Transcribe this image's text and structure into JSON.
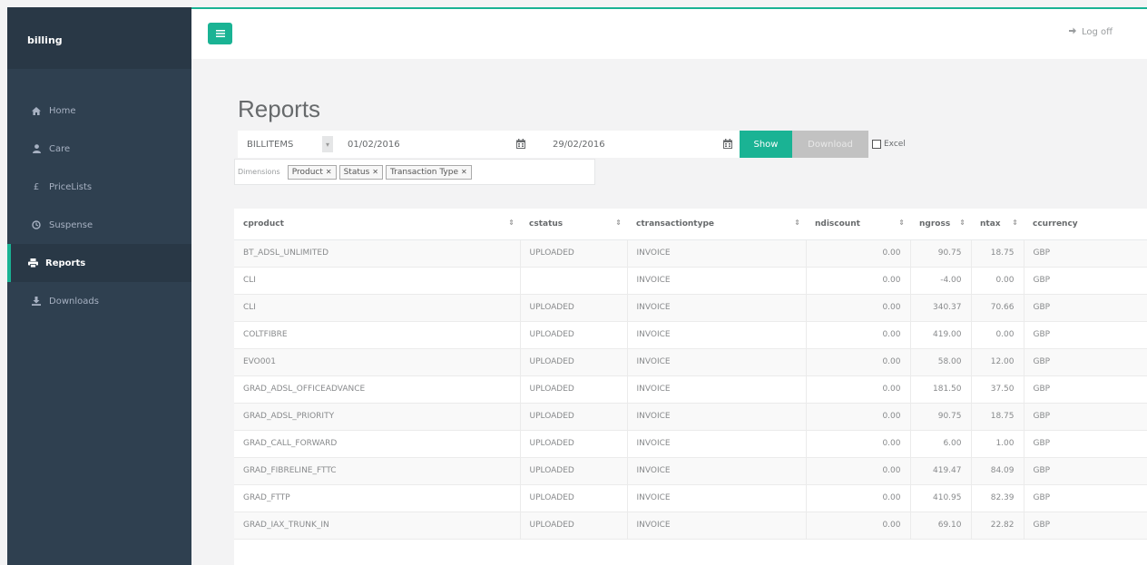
{
  "app": {
    "brand": "billing"
  },
  "sidebar": {
    "items": [
      {
        "label": "Home",
        "icon": "home-icon"
      },
      {
        "label": "Care",
        "icon": "user-icon"
      },
      {
        "label": "PriceLists",
        "icon": "pound-icon"
      },
      {
        "label": "Suspense",
        "icon": "clock-icon"
      },
      {
        "label": "Reports",
        "icon": "print-icon",
        "active": true
      },
      {
        "label": "Downloads",
        "icon": "download-icon"
      }
    ]
  },
  "topbar": {
    "logoff_label": "Log off"
  },
  "page": {
    "title": "Reports"
  },
  "filters": {
    "report_type": "BILLITEMS",
    "date_from": "01/02/2016",
    "date_to": "29/02/2016",
    "show_label": "Show",
    "download_label": "Download",
    "excel_label": "Excel",
    "excel_checked": false,
    "dimensions_label": "Dimensions",
    "dimensions": [
      "Product",
      "Status",
      "Transaction Type"
    ]
  },
  "colors": {
    "accent": "#1ab394",
    "sidebar": "#2f4050"
  },
  "table": {
    "columns": [
      "cproduct",
      "cstatus",
      "ctransactiontype",
      "ndiscount",
      "ngross",
      "ntax",
      "ccurrency"
    ],
    "rows": [
      [
        "BT_ADSL_UNLIMITED",
        "UPLOADED",
        "INVOICE",
        "0.00",
        "90.75",
        "18.75",
        "GBP"
      ],
      [
        "CLI",
        "",
        "INVOICE",
        "0.00",
        "-4.00",
        "0.00",
        "GBP"
      ],
      [
        "CLI",
        "UPLOADED",
        "INVOICE",
        "0.00",
        "340.37",
        "70.66",
        "GBP"
      ],
      [
        "COLTFIBRE",
        "UPLOADED",
        "INVOICE",
        "0.00",
        "419.00",
        "0.00",
        "GBP"
      ],
      [
        "EVO001",
        "UPLOADED",
        "INVOICE",
        "0.00",
        "58.00",
        "12.00",
        "GBP"
      ],
      [
        "GRAD_ADSL_OFFICEADVANCE",
        "UPLOADED",
        "INVOICE",
        "0.00",
        "181.50",
        "37.50",
        "GBP"
      ],
      [
        "GRAD_ADSL_PRIORITY",
        "UPLOADED",
        "INVOICE",
        "0.00",
        "90.75",
        "18.75",
        "GBP"
      ],
      [
        "GRAD_CALL_FORWARD",
        "UPLOADED",
        "INVOICE",
        "0.00",
        "6.00",
        "1.00",
        "GBP"
      ],
      [
        "GRAD_FIBRELINE_FTTC",
        "UPLOADED",
        "INVOICE",
        "0.00",
        "419.47",
        "84.09",
        "GBP"
      ],
      [
        "GRAD_FTTP",
        "UPLOADED",
        "INVOICE",
        "0.00",
        "410.95",
        "82.39",
        "GBP"
      ],
      [
        "GRAD_IAX_TRUNK_IN",
        "UPLOADED",
        "INVOICE",
        "0.00",
        "69.10",
        "22.82",
        "GBP"
      ]
    ]
  }
}
